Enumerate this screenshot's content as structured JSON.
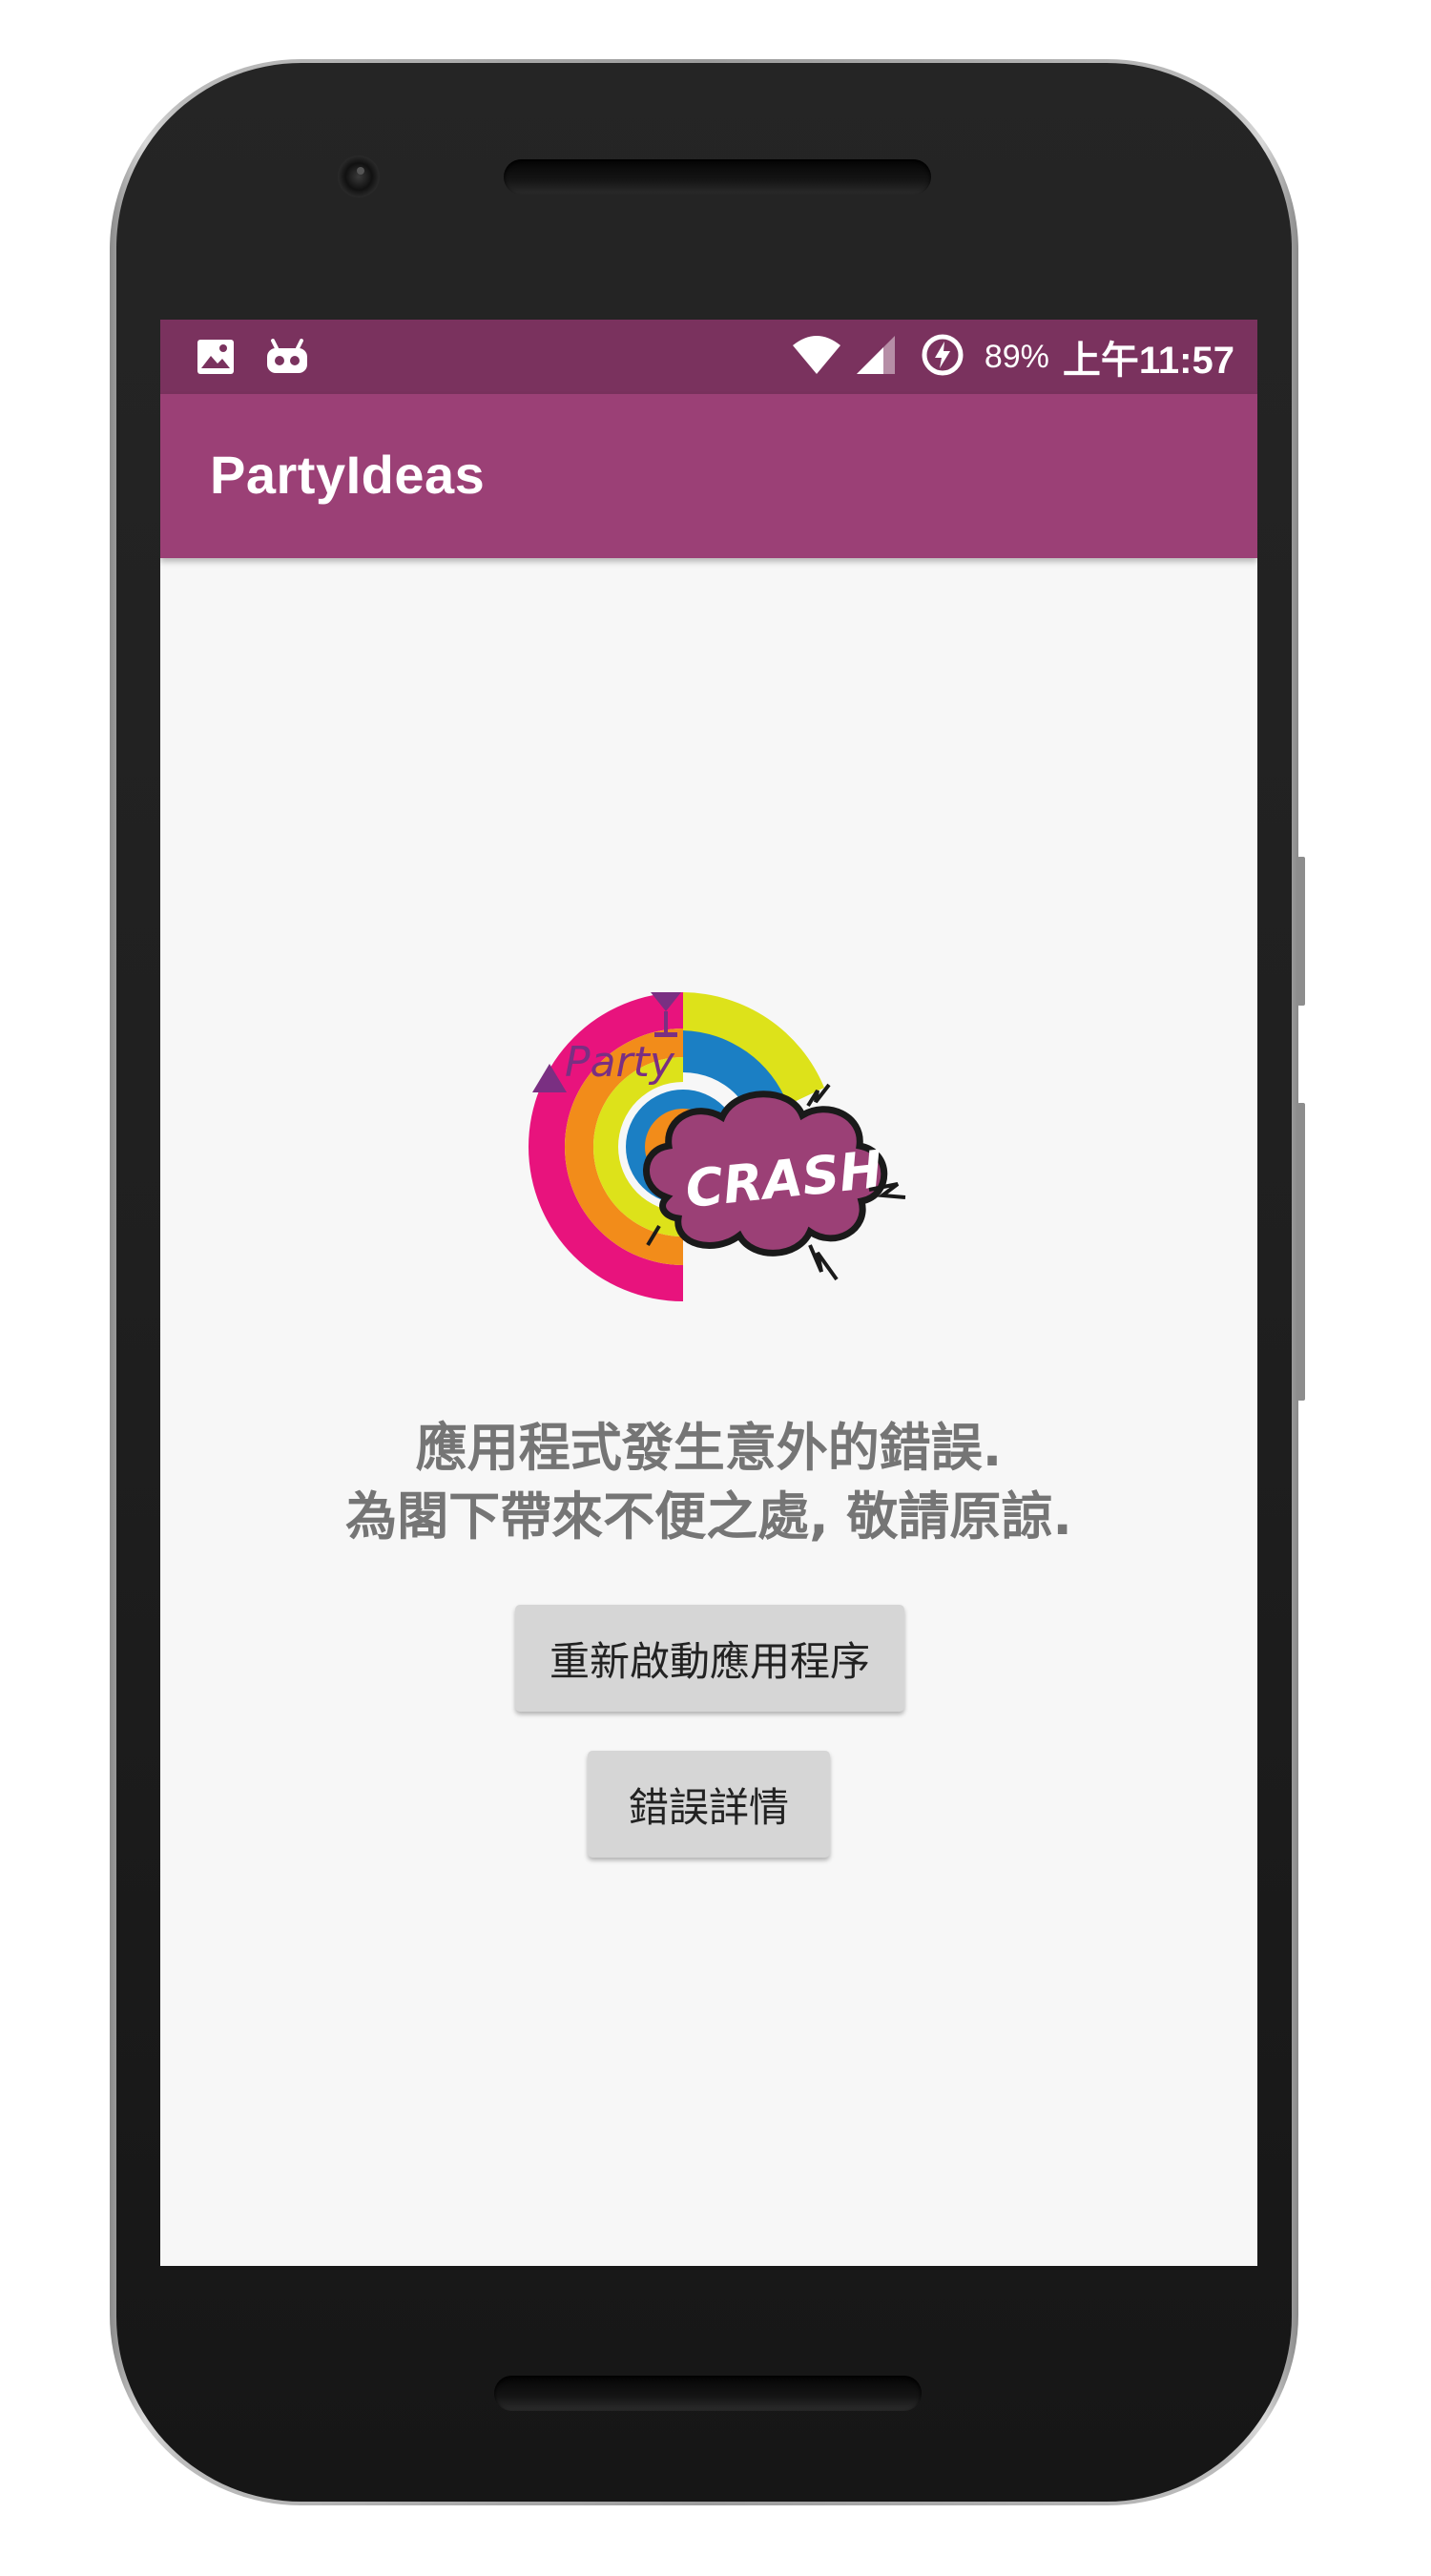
{
  "status_bar": {
    "left_icons": [
      "image-icon",
      "robot-icon"
    ],
    "right_icons": [
      "wifi-icon",
      "cellular-signal-icon",
      "battery-saver-icon"
    ],
    "battery_text": "89%",
    "time_text": "上午11:57"
  },
  "app_bar": {
    "title": "PartyIdeas"
  },
  "logo": {
    "party_text": "Party",
    "crash_text": "CRASH"
  },
  "error": {
    "line1": "應用程式發生意外的錯誤.",
    "line2": "為閣下帶來不便之處, 敬請原諒."
  },
  "buttons": {
    "restart_label": "重新啟動應用程序",
    "details_label": "錯誤詳情"
  },
  "colors": {
    "status_bar": "#7a325e",
    "app_bar": "#9b4076",
    "background": "#f7f7f7",
    "button": "#d6d6d6",
    "message_text": "#757575"
  }
}
